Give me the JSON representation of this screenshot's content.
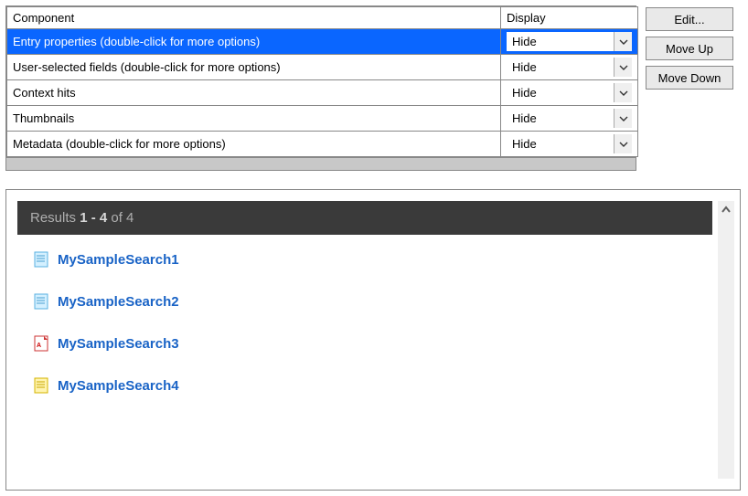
{
  "grid": {
    "headers": {
      "component": "Component",
      "display": "Display"
    },
    "rows": [
      {
        "label": "Entry properties  (double-click for more options)",
        "display": "Hide",
        "selected": true
      },
      {
        "label": "User-selected fields  (double-click for more options)",
        "display": "Hide",
        "selected": false
      },
      {
        "label": "Context hits",
        "display": "Hide",
        "selected": false
      },
      {
        "label": "Thumbnails",
        "display": "Hide",
        "selected": false
      },
      {
        "label": "Metadata  (double-click for more options)",
        "display": "Hide",
        "selected": false
      }
    ]
  },
  "buttons": {
    "edit": "Edit...",
    "moveUp": "Move Up",
    "moveDown": "Move Down"
  },
  "results": {
    "headerPrefix": "Results ",
    "rangeBold": "1 - 4",
    "ofText": " of 4",
    "items": [
      {
        "title": "MySampleSearch1",
        "icon": "doc-blue"
      },
      {
        "title": "MySampleSearch2",
        "icon": "doc-blue"
      },
      {
        "title": "MySampleSearch3",
        "icon": "pdf"
      },
      {
        "title": "MySampleSearch4",
        "icon": "doc-yellow"
      }
    ]
  }
}
